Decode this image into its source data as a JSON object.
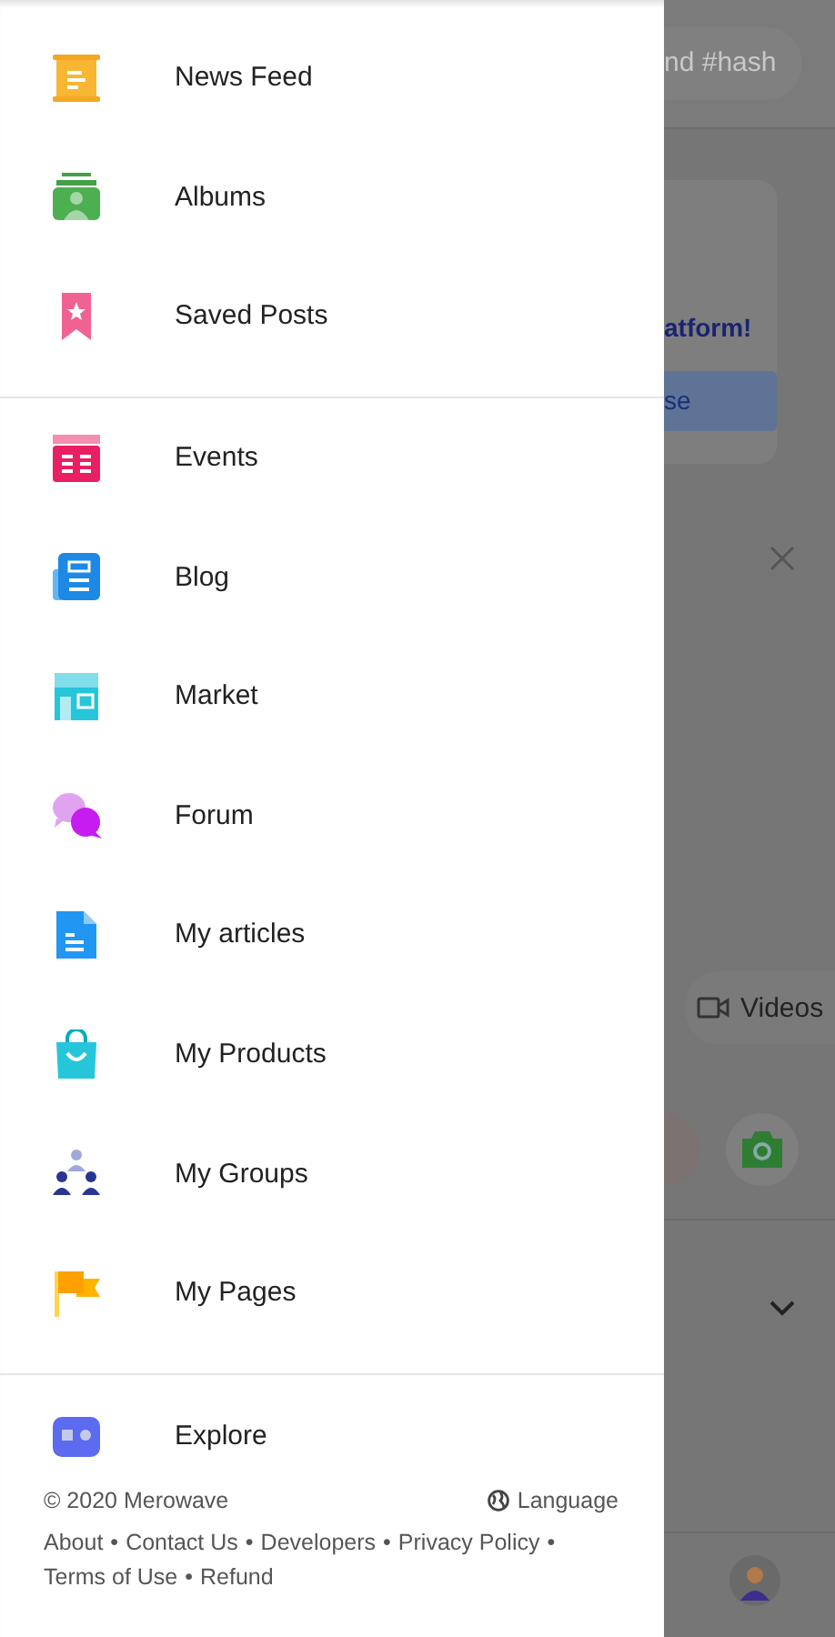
{
  "drawer": {
    "sections": [
      {
        "items": [
          {
            "label": "News Feed"
          },
          {
            "label": "Albums"
          },
          {
            "label": "Saved Posts"
          }
        ]
      },
      {
        "items": [
          {
            "label": "Events"
          },
          {
            "label": "Blog"
          },
          {
            "label": "Market"
          },
          {
            "label": "Forum"
          },
          {
            "label": "My articles"
          },
          {
            "label": "My Products"
          },
          {
            "label": "My Groups"
          },
          {
            "label": "My Pages"
          }
        ]
      },
      {
        "items": [
          {
            "label": "Explore"
          }
        ]
      }
    ],
    "footer": {
      "copyright": "© 2020 Merowave",
      "language": "Language",
      "separator": "•",
      "links": [
        "About",
        "Contact Us",
        "Developers",
        "Privacy Policy",
        "Terms of Use",
        "Refund"
      ]
    }
  },
  "background": {
    "search_text": "nd #hash",
    "card_title": "atform!",
    "card_button": "se",
    "media_chip": "Videos"
  }
}
